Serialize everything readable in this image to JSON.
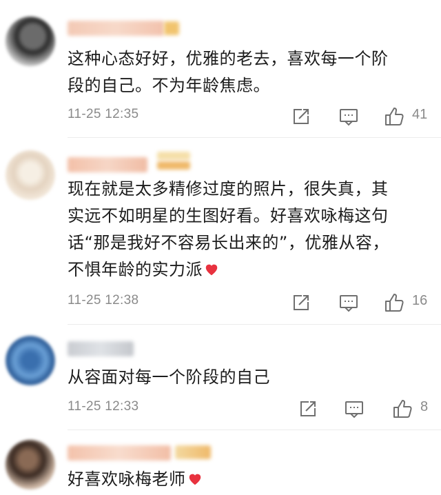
{
  "comments": [
    {
      "text_lines": [
        "这种心态好好，优雅的老去，喜欢每一个阶",
        "段的自己。不为年龄焦虑。"
      ],
      "time": "11-25 12:35",
      "likes": "41"
    },
    {
      "text_lines": [
        "现在就是太多精修过度的照片，很失真，其",
        "实远不如明星的生图好看。好喜欢咏梅这句",
        "话“那是我好不容易长出来的”，优雅从容，",
        "不惧年龄的实力派"
      ],
      "has_heart": true,
      "time": "11-25 12:38",
      "likes": "16"
    },
    {
      "text_lines": [
        "从容面对每一个阶段的自己"
      ],
      "time": "11-25 12:33",
      "likes": "8"
    },
    {
      "text_lines": [
        "好喜欢咏梅老师"
      ],
      "has_heart": true
    }
  ],
  "icons": {
    "share": "share-icon",
    "reply": "comment-icon",
    "like": "thumbs-up-icon",
    "heart": "red-heart-emoji"
  },
  "colors": {
    "heart": "#e8323f",
    "meta_text": "#8a8a8a",
    "icon_stroke": "#6f6f6f"
  }
}
